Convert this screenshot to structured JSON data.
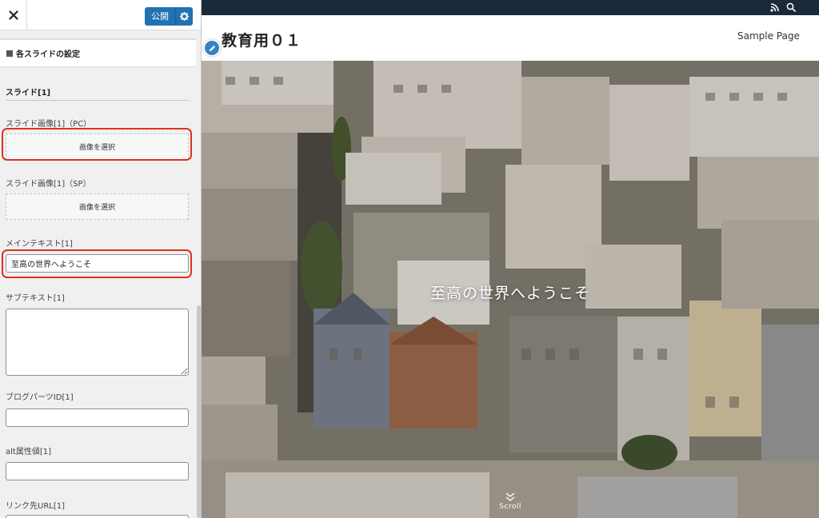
{
  "customizer": {
    "publish_label": "公開",
    "section_title": "各スライドの設定",
    "slide_heading": "スライド[1]",
    "fields": {
      "slide_image_pc_label": "スライド画像[1]（PC）",
      "slide_image_pc_button": "画像を選択",
      "slide_image_sp_label": "スライド画像[1]（SP）",
      "slide_image_sp_button": "画像を選択",
      "main_text_label": "メインテキスト[1]",
      "main_text_value": "至高の世界へようこそ",
      "sub_text_label": "サブテキスト[1]",
      "sub_text_value": "",
      "blog_parts_label": "ブログパーツID[1]",
      "blog_parts_value": "",
      "alt_label": "alt属性値[1]",
      "alt_value": "",
      "link_url_label": "リンク先URL[1]"
    },
    "accent_color": "#2271b1",
    "callout_color": "#e0301e"
  },
  "preview": {
    "site_title": "教育用０１",
    "nav_items": [
      "Sample Page"
    ],
    "hero_text": "至高の世界へようこそ",
    "scroll_label": "Scroll",
    "topbar_color": "#1a2a3a",
    "icons": [
      "rss-icon",
      "search-icon",
      "edit-pencil-icon"
    ]
  }
}
